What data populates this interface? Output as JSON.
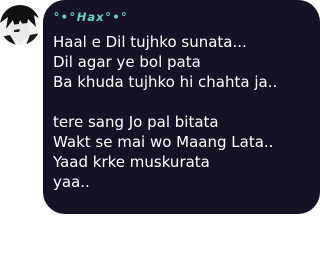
{
  "message": {
    "sender_name": "°•°𝙃𝙖𝙭°•°",
    "lines": [
      "Haal e Dil tujhko sunata...",
      "Dil agar ye bol pata",
      "Ba khuda tujhko hi chahta ja..",
      "",
      "tere sang Jo pal bitata",
      "Wakt se mai wo Maang Lata..",
      "Yaad krke muskurata",
      "yaa.."
    ]
  },
  "colors": {
    "bubble_background": "#161226",
    "sender_name": "#5fd3c5",
    "message_text": "#ffffff"
  },
  "icons": {
    "avatar": "anime-character-avatar"
  }
}
